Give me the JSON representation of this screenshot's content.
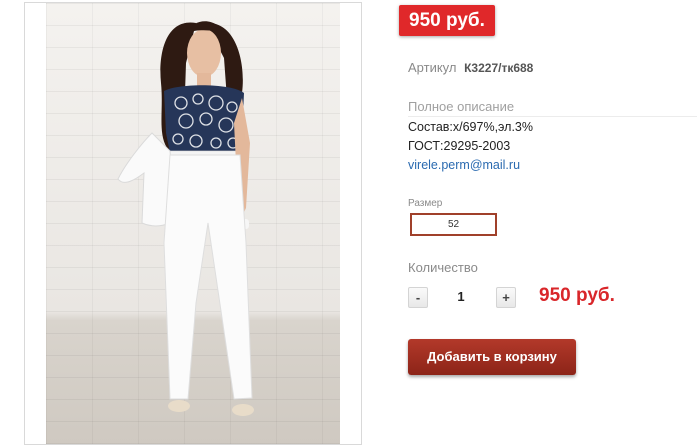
{
  "product": {
    "price_badge": "950 руб.",
    "sku_label": "Артикул",
    "sku_value": "К3227/тк688",
    "description_title": "Полное описание",
    "description_lines": [
      "Состав:х/697%,эл.3%",
      "ГОСТ:29295-2003"
    ],
    "contact_email": "virele.perm@mail.ru",
    "size_label": "Размер",
    "size_selected": "52",
    "quantity_label": "Количество",
    "quantity_minus": "-",
    "quantity_value": "1",
    "quantity_plus": "+",
    "total_price": "950 руб.",
    "add_to_cart": "Добавить в корзину"
  },
  "colors": {
    "badge_red": "#e0282a",
    "price_red": "#d9262a",
    "cart_button": "#a0301f",
    "size_border": "#a0402a",
    "link_blue": "#2a6ab0"
  }
}
